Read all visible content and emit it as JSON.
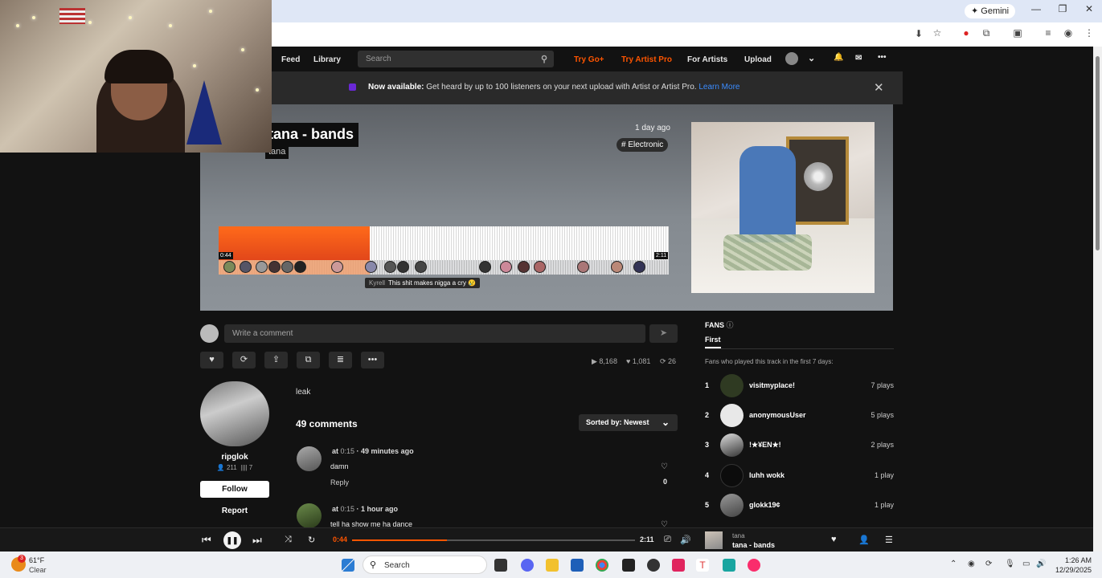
{
  "browser": {
    "gemini_label": "Gemini",
    "window_controls": [
      "—",
      "❐",
      "✕"
    ]
  },
  "nav": {
    "feed": "Feed",
    "library": "Library",
    "search_placeholder": "Search",
    "try_go_plus": "Try Go+",
    "try_artist_pro": "Try Artist Pro",
    "for_artists": "For Artists",
    "upload": "Upload"
  },
  "banner": {
    "bold": "Now available:",
    "text": " Get heard by up to 100 listeners on your next upload with Artist or Artist Pro. ",
    "link": "Learn More"
  },
  "track": {
    "title": "tana - bands",
    "artist": "tana",
    "posted": "1 day ago",
    "genre": "# Electronic",
    "current_time": "0:44",
    "duration": "2:11",
    "progress": 0.336,
    "comment_tip_user": "Kyrell",
    "comment_tip_text": "This shit makes nigga a cry 😢"
  },
  "comment_input": {
    "placeholder": "Write a comment"
  },
  "stats": {
    "plays": "8,168",
    "likes": "1,081",
    "reposts": "26"
  },
  "uploader": {
    "name": "ripglok",
    "followers": "211",
    "tracks": "7",
    "follow_label": "Follow",
    "report_label": "Report"
  },
  "description": "leak",
  "comments": {
    "count_label": "49 comments",
    "sort_label": "Sorted by: Newest",
    "items": [
      {
        "at": "at ",
        "ts": "0:15",
        "ago": " · 49 minutes ago",
        "text": "damn",
        "reply": "Reply",
        "likes": "0"
      },
      {
        "at": "at ",
        "ts": "0:15",
        "ago": " · 1 hour ago",
        "text": "tell ha show me ha dance",
        "reply": "",
        "likes": ""
      }
    ]
  },
  "fans": {
    "title": "FANS",
    "tab": "First",
    "subtitle": "Fans who played this track in the first 7 days:",
    "items": [
      {
        "rank": "1",
        "name": "visitmyplace!",
        "plays": "7 plays"
      },
      {
        "rank": "2",
        "name": "anonymousUser",
        "plays": "5 plays"
      },
      {
        "rank": "3",
        "name": "!★¥EN★!",
        "plays": "2 plays"
      },
      {
        "rank": "4",
        "name": "luhh wokk",
        "plays": "1 play"
      },
      {
        "rank": "5",
        "name": "glokk19¢",
        "plays": "1 play"
      }
    ]
  },
  "player": {
    "current": "0:44",
    "total": "2:11",
    "progress": 0.336,
    "np_artist": "tana",
    "np_title": "tana - bands"
  },
  "taskbar": {
    "temp": "61°F",
    "condition": "Clear",
    "weather_badge": "3",
    "search_label": "Search",
    "time": "1:26 AM",
    "date": "12/29/2025"
  },
  "colors": {
    "accent": "#ff5500",
    "link": "#3b8cff"
  }
}
